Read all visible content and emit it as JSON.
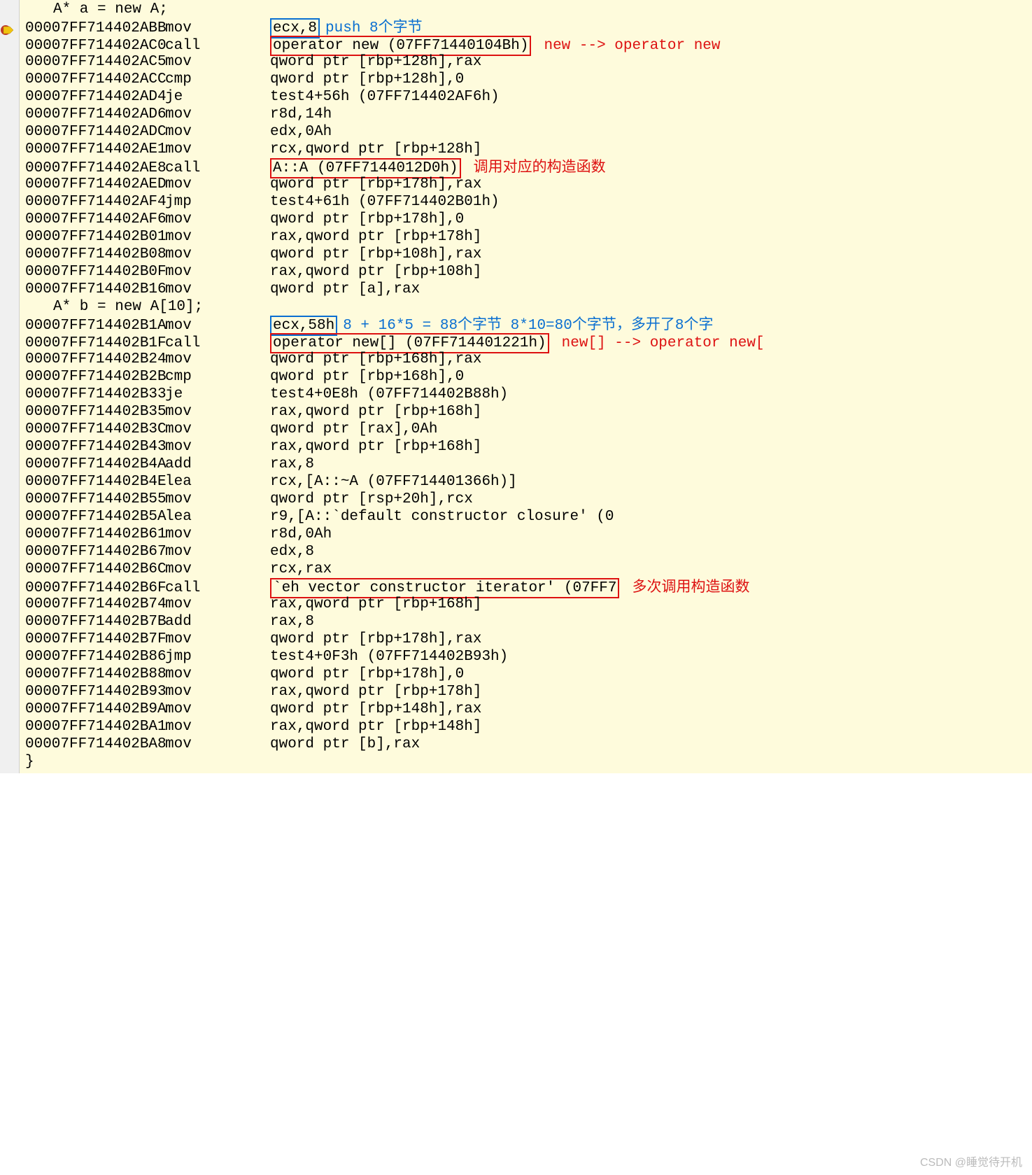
{
  "sourceLines": {
    "l0": "A* a = new A;",
    "l1": "A* b = new A[10];",
    "close": "}"
  },
  "annotations": {
    "push8": "push 8个字节",
    "newToOpNew": "new --> operator new",
    "callCtor": "调用对应的构造函数",
    "eighty8": "8 + 16*5 = 88个字节 8*10=80个字节，多开了8个字",
    "newArrToOp": "new[] --> operator new[",
    "multiCall": "多次调用构造函数"
  },
  "rows": [
    {
      "addr": "00007FF714402ABB",
      "m": "mov",
      "ops": "ecx,8",
      "boxOps": "blue",
      "ann": "push8",
      "annCls": "ann-blue"
    },
    {
      "addr": "00007FF714402AC0",
      "m": "call",
      "ops": "operator new (07FF71440104Bh)",
      "boxOps": "red",
      "ann": "newToOpNew",
      "annCls": "ann-red"
    },
    {
      "addr": "00007FF714402AC5",
      "m": "mov",
      "ops": "qword ptr [rbp+128h],rax"
    },
    {
      "addr": "00007FF714402ACC",
      "m": "cmp",
      "ops": "qword ptr [rbp+128h],0"
    },
    {
      "addr": "00007FF714402AD4",
      "m": "je",
      "ops": "test4+56h (07FF714402AF6h)"
    },
    {
      "addr": "00007FF714402AD6",
      "m": "mov",
      "ops": "r8d,14h"
    },
    {
      "addr": "00007FF714402ADC",
      "m": "mov",
      "ops": "edx,0Ah"
    },
    {
      "addr": "00007FF714402AE1",
      "m": "mov",
      "ops": "rcx,qword ptr [rbp+128h]"
    },
    {
      "addr": "00007FF714402AE8",
      "m": "call",
      "ops": "A::A (07FF7144012D0h)",
      "boxOps": "red",
      "ann": "callCtor",
      "annCls": "ann-red"
    },
    {
      "addr": "00007FF714402AED",
      "m": "mov",
      "ops": "qword ptr [rbp+178h],rax"
    },
    {
      "addr": "00007FF714402AF4",
      "m": "jmp",
      "ops": "test4+61h (07FF714402B01h)"
    },
    {
      "addr": "00007FF714402AF6",
      "m": "mov",
      "ops": "qword ptr [rbp+178h],0"
    },
    {
      "addr": "00007FF714402B01",
      "m": "mov",
      "ops": "rax,qword ptr [rbp+178h]"
    },
    {
      "addr": "00007FF714402B08",
      "m": "mov",
      "ops": "qword ptr [rbp+108h],rax"
    },
    {
      "addr": "00007FF714402B0F",
      "m": "mov",
      "ops": "rax,qword ptr [rbp+108h]"
    },
    {
      "addr": "00007FF714402B16",
      "m": "mov",
      "ops": "qword ptr [a],rax"
    },
    {
      "addr": "00007FF714402B1A",
      "m": "mov",
      "ops": "ecx,58h",
      "boxOps": "blue",
      "ann": "eighty8",
      "annCls": "ann-blue"
    },
    {
      "addr": "00007FF714402B1F",
      "m": "call",
      "ops": "operator new[] (07FF714401221h)",
      "boxOps": "red",
      "ann": "newArrToOp",
      "annCls": "ann-red"
    },
    {
      "addr": "00007FF714402B24",
      "m": "mov",
      "ops": "qword ptr [rbp+168h],rax"
    },
    {
      "addr": "00007FF714402B2B",
      "m": "cmp",
      "ops": "qword ptr [rbp+168h],0"
    },
    {
      "addr": "00007FF714402B33",
      "m": "je",
      "ops": "test4+0E8h (07FF714402B88h)"
    },
    {
      "addr": "00007FF714402B35",
      "m": "mov",
      "ops": "rax,qword ptr [rbp+168h]"
    },
    {
      "addr": "00007FF714402B3C",
      "m": "mov",
      "ops": "qword ptr [rax],0Ah"
    },
    {
      "addr": "00007FF714402B43",
      "m": "mov",
      "ops": "rax,qword ptr [rbp+168h]"
    },
    {
      "addr": "00007FF714402B4A",
      "m": "add",
      "ops": "rax,8"
    },
    {
      "addr": "00007FF714402B4E",
      "m": "lea",
      "ops": "rcx,[A::~A (07FF714401366h)]"
    },
    {
      "addr": "00007FF714402B55",
      "m": "mov",
      "ops": "qword ptr [rsp+20h],rcx"
    },
    {
      "addr": "00007FF714402B5A",
      "m": "lea",
      "ops": "r9,[A::`default constructor closure' (0"
    },
    {
      "addr": "00007FF714402B61",
      "m": "mov",
      "ops": "r8d,0Ah"
    },
    {
      "addr": "00007FF714402B67",
      "m": "mov",
      "ops": "edx,8"
    },
    {
      "addr": "00007FF714402B6C",
      "m": "mov",
      "ops": "rcx,rax"
    },
    {
      "addr": "00007FF714402B6F",
      "m": "call",
      "ops": "`eh vector constructor iterator' (07FF7",
      "boxOps": "red",
      "ann": "multiCall",
      "annCls": "ann-red"
    },
    {
      "addr": "00007FF714402B74",
      "m": "mov",
      "ops": "rax,qword ptr [rbp+168h]"
    },
    {
      "addr": "00007FF714402B7B",
      "m": "add",
      "ops": "rax,8"
    },
    {
      "addr": "00007FF714402B7F",
      "m": "mov",
      "ops": "qword ptr [rbp+178h],rax"
    },
    {
      "addr": "00007FF714402B86",
      "m": "jmp",
      "ops": "test4+0F3h (07FF714402B93h)"
    },
    {
      "addr": "00007FF714402B88",
      "m": "mov",
      "ops": "qword ptr [rbp+178h],0"
    },
    {
      "addr": "00007FF714402B93",
      "m": "mov",
      "ops": "rax,qword ptr [rbp+178h]"
    },
    {
      "addr": "00007FF714402B9A",
      "m": "mov",
      "ops": "qword ptr [rbp+148h],rax"
    },
    {
      "addr": "00007FF714402BA1",
      "m": "mov",
      "ops": "rax,qword ptr [rbp+148h]"
    },
    {
      "addr": "00007FF714402BA8",
      "m": "mov",
      "ops": "qword ptr [b],rax"
    }
  ],
  "watermark": "CSDN @睡觉待开机"
}
